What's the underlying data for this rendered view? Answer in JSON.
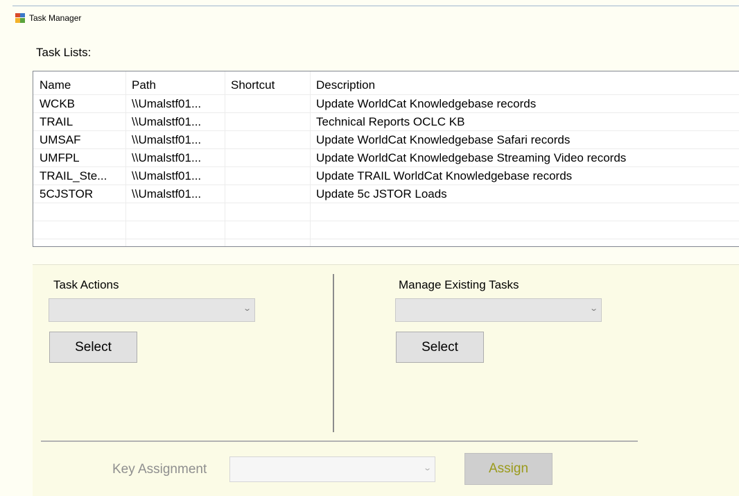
{
  "window": {
    "title": "Task Manager"
  },
  "task_lists": {
    "label": "Task Lists:",
    "columns": [
      "Name",
      "Path",
      "Shortcut",
      "Description"
    ],
    "rows": [
      {
        "name": "WCKB",
        "path": "\\\\Umalstf01...",
        "shortcut": "",
        "description": "Update WorldCat Knowledgebase records"
      },
      {
        "name": "TRAIL",
        "path": "\\\\Umalstf01...",
        "shortcut": "",
        "description": "Technical Reports OCLC KB"
      },
      {
        "name": "UMSAF",
        "path": "\\\\Umalstf01...",
        "shortcut": "",
        "description": "Update WorldCat Knowledgebase Safari records"
      },
      {
        "name": "UMFPL",
        "path": "\\\\Umalstf01...",
        "shortcut": "",
        "description": "Update WorldCat Knowledgebase Streaming Video records"
      },
      {
        "name": "TRAIL_Ste...",
        "path": "\\\\Umalstf01...",
        "shortcut": "",
        "description": "Update TRAIL WorldCat Knowledgebase records"
      },
      {
        "name": "5CJSTOR",
        "path": "\\\\Umalstf01...",
        "shortcut": "",
        "description": "Update 5c JSTOR Loads"
      }
    ]
  },
  "task_actions": {
    "title": "Task Actions",
    "selected": "",
    "button": "Select"
  },
  "manage_tasks": {
    "title": "Manage Existing Tasks",
    "selected": "",
    "button": "Select"
  },
  "key_assignment": {
    "label": "Key Assignment",
    "selected": "",
    "button": "Assign"
  },
  "icons": {
    "app": "task-manager-app-icon",
    "dropdown": "chevron-down-icon"
  }
}
